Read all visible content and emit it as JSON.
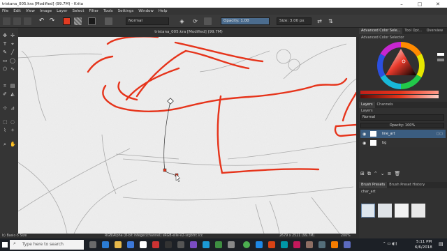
{
  "window": {
    "title": "tristana_005.kra [Modified]  (99.7M) - Krita",
    "controls": [
      "–",
      "□",
      "✕"
    ]
  },
  "menu": [
    "File",
    "Edit",
    "View",
    "Image",
    "Layer",
    "Select",
    "Filter",
    "Tools",
    "Settings",
    "Window",
    "Help"
  ],
  "toolbar": {
    "blend_mode": "Normal",
    "opacity_label": "Opacity: 1.00",
    "size_label": "Size: 3.00 px",
    "fg_color": "#e23b22",
    "bg_color": "#ffffff"
  },
  "document_tab": {
    "title": "tristana_005.kra [Modified]  (99.7M)"
  },
  "status": {
    "brush": "b) Basic-5 Size",
    "colorspace": "RGB/Alpha (8-bit integer/channel)  sRGB-elle-V2-srgbtrc.icc",
    "dimensions": "2679 x 2521 (99.7M)",
    "zoom": "200%"
  },
  "dock": {
    "top_tabs": [
      "Advanced Color Sele...",
      "Tool Opt...",
      "Overview"
    ],
    "color_selector_title": "Advanced Color Selector",
    "layer_tabs": [
      "Layers",
      "Channels"
    ],
    "layers_title": "Layers",
    "blend": "Normal",
    "opacity": "Opacity:  100%",
    "layers": [
      {
        "name": "line_art",
        "selected": true
      },
      {
        "name": "bg",
        "selected": false
      }
    ],
    "presets_tabs": [
      "Brush Presets",
      "Brush Preset History"
    ],
    "preset_filter": "char_art"
  },
  "taskbar": {
    "search_placeholder": "Type here to search",
    "time": "5:11 PM",
    "date": "6/6/2018"
  },
  "colors": {
    "accent": "#4a90d9",
    "stroke": "#e6341b",
    "selected_layer": "#3b5d80"
  }
}
